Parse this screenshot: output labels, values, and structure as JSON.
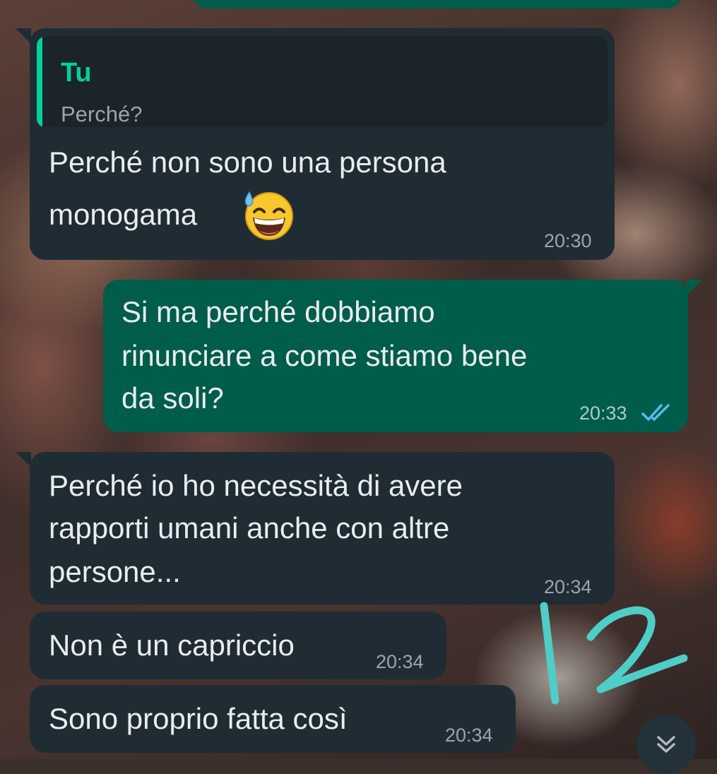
{
  "messages": [
    {
      "direction": "incoming",
      "quote": {
        "author": "Tu",
        "text": "Perché?"
      },
      "lines": [
        "Perché non sono una persona",
        "monogama"
      ],
      "emoji": "grinning-face-with-sweat",
      "time": "20:30"
    },
    {
      "direction": "outgoing",
      "lines": [
        "Si ma perché dobbiamo",
        "rinunciare a come stiamo bene",
        "da soli?"
      ],
      "time": "20:33",
      "status": "read"
    },
    {
      "direction": "incoming",
      "lines": [
        "Perché io ho necessità di avere",
        "rapporti umani anche con altre",
        "persone..."
      ],
      "time": "20:34"
    },
    {
      "direction": "incoming",
      "lines": [
        "Non è un capriccio"
      ],
      "time": "20:34"
    },
    {
      "direction": "incoming",
      "lines": [
        "Sono proprio fatta così"
      ],
      "time": "20:34"
    }
  ],
  "annotation": {
    "text": "12",
    "color": "#4fcdc7"
  },
  "colors": {
    "incoming_bubble": "#1f2c33",
    "outgoing_bubble": "#005c4b",
    "quote_accent": "#06cf9c",
    "read_ticks": "#53bdeb"
  },
  "scroll_button": {
    "icon": "double-chevron-down-icon"
  }
}
